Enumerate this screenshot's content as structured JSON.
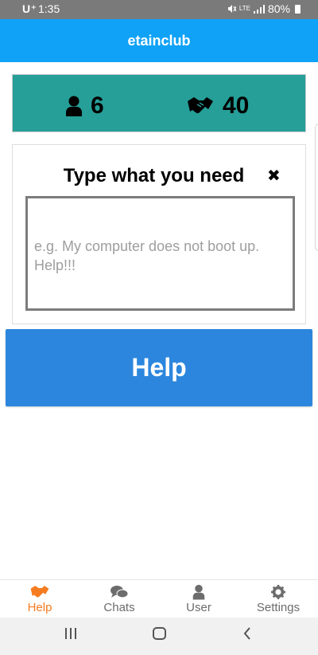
{
  "status": {
    "carrier": "U⁺",
    "time": "1:35",
    "network": "LTE",
    "battery": "80%"
  },
  "app": {
    "title": "etainclub"
  },
  "stats": {
    "users_icon": "user-icon",
    "users_count": "6",
    "helps_icon": "handshake-icon",
    "helps_count": "40"
  },
  "request": {
    "title": "Type what you need",
    "placeholder": "e.g. My computer does not boot up. Help!!!",
    "value": ""
  },
  "help_button": {
    "label": "Help"
  },
  "nav": {
    "items": [
      {
        "label": "Help",
        "icon": "handshake-icon",
        "active": true
      },
      {
        "label": "Chats",
        "icon": "chat-icon",
        "active": false
      },
      {
        "label": "User",
        "icon": "user-icon",
        "active": false
      },
      {
        "label": "Settings",
        "icon": "gear-icon",
        "active": false
      }
    ]
  },
  "colors": {
    "app_bar": "#0fa2f6",
    "stats_bg": "#259f98",
    "help_button": "#2c86dd",
    "active_nav": "#f57c20"
  }
}
